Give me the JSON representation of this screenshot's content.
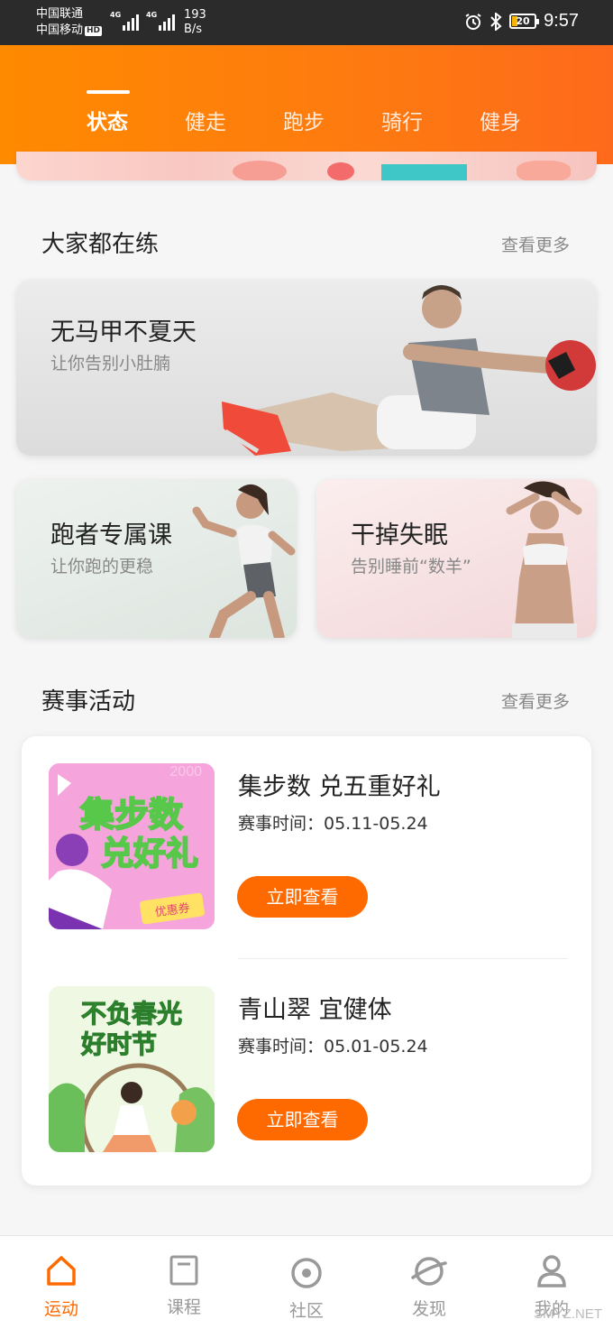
{
  "status_bar": {
    "carrier_1": "中国联通",
    "carrier_2": "中国移动",
    "hd_badge": "HD",
    "network_1": "4G",
    "network_2": "4G",
    "speed_value": "193",
    "speed_unit": "B/s",
    "battery": "20",
    "time": "9:57"
  },
  "tabs": [
    {
      "label": "状态",
      "active": true
    },
    {
      "label": "健走",
      "active": false
    },
    {
      "label": "跑步",
      "active": false
    },
    {
      "label": "骑行",
      "active": false
    },
    {
      "label": "健身",
      "active": false
    }
  ],
  "popular": {
    "title": "大家都在练",
    "more": "查看更多",
    "cards": [
      {
        "title": "无马甲不夏天",
        "subtitle": "让你告别小肚腩"
      },
      {
        "title": "跑者专属课",
        "subtitle": "让你跑的更稳"
      },
      {
        "title": "干掉失眠",
        "subtitle": "告别睡前“数羊”"
      }
    ]
  },
  "events": {
    "title": "赛事活动",
    "more": "查看更多",
    "items": [
      {
        "name": "集步数  兑五重好礼",
        "time": "赛事时间：05.11-05.24",
        "button": "立即查看",
        "poster_text_1": "集步数",
        "poster_text_2": "兑好礼",
        "poster_tag": "优惠券",
        "poster_bg_text": "2000"
      },
      {
        "name": "青山翠  宜健体",
        "time": "赛事时间：05.01-05.24",
        "button": "立即查看",
        "poster_text_1": "不负春光",
        "poster_text_2": "好时节"
      }
    ]
  },
  "bottom_nav": [
    {
      "label": "运动",
      "icon": "home-icon",
      "active": true
    },
    {
      "label": "课程",
      "icon": "course-icon",
      "active": false
    },
    {
      "label": "社区",
      "icon": "community-icon",
      "active": false
    },
    {
      "label": "发现",
      "icon": "discover-icon",
      "active": false
    },
    {
      "label": "我的",
      "icon": "profile-icon",
      "active": false
    }
  ],
  "watermark": "SMYZ.NET",
  "colors": {
    "accent": "#fe6a00",
    "header_start": "#fe8a00",
    "header_end": "#fe6a1c"
  }
}
